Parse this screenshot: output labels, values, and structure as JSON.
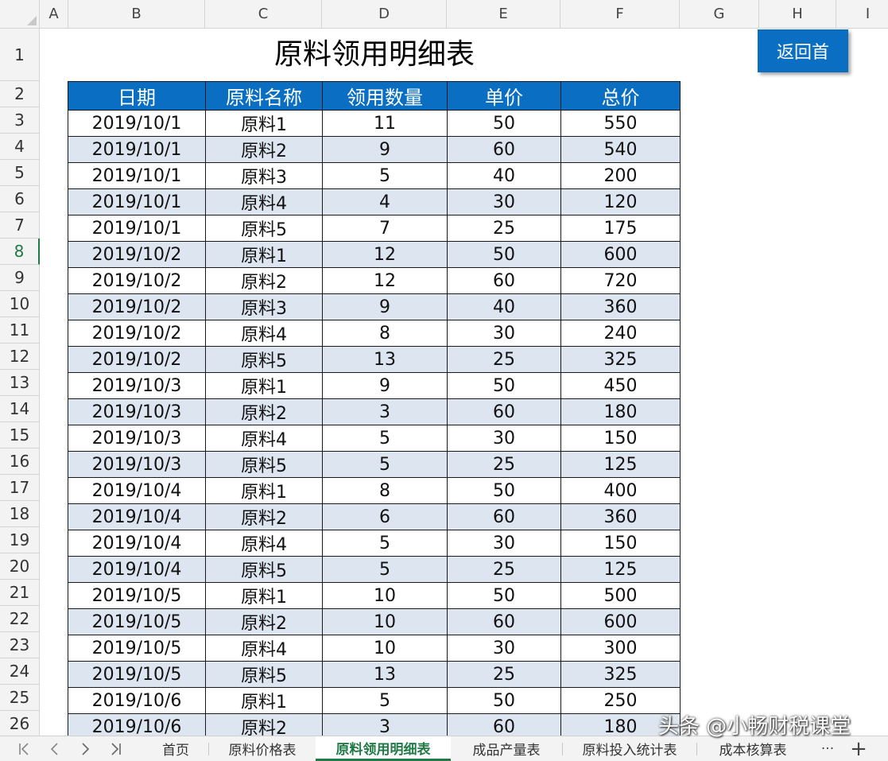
{
  "columns": [
    "A",
    "B",
    "C",
    "D",
    "E",
    "F",
    "G",
    "H",
    "I"
  ],
  "rows": [
    "1",
    "2",
    "3",
    "4",
    "5",
    "6",
    "7",
    "8",
    "9",
    "10",
    "11",
    "12",
    "13",
    "14",
    "15",
    "16",
    "17",
    "18",
    "19",
    "20",
    "21",
    "22",
    "23",
    "24",
    "25",
    "26"
  ],
  "title": "原料领用明细表",
  "return_button": "返回首",
  "table": {
    "headers": [
      "日期",
      "原料名称",
      "领用数量",
      "单价",
      "总价"
    ],
    "rows": [
      [
        "2019/10/1",
        "原料1",
        "11",
        "50",
        "550"
      ],
      [
        "2019/10/1",
        "原料2",
        "9",
        "60",
        "540"
      ],
      [
        "2019/10/1",
        "原料3",
        "5",
        "40",
        "200"
      ],
      [
        "2019/10/1",
        "原料4",
        "4",
        "30",
        "120"
      ],
      [
        "2019/10/1",
        "原料5",
        "7",
        "25",
        "175"
      ],
      [
        "2019/10/2",
        "原料1",
        "12",
        "50",
        "600"
      ],
      [
        "2019/10/2",
        "原料2",
        "12",
        "60",
        "720"
      ],
      [
        "2019/10/2",
        "原料3",
        "9",
        "40",
        "360"
      ],
      [
        "2019/10/2",
        "原料4",
        "8",
        "30",
        "240"
      ],
      [
        "2019/10/2",
        "原料5",
        "13",
        "25",
        "325"
      ],
      [
        "2019/10/3",
        "原料1",
        "9",
        "50",
        "450"
      ],
      [
        "2019/10/3",
        "原料2",
        "3",
        "60",
        "180"
      ],
      [
        "2019/10/3",
        "原料4",
        "5",
        "30",
        "150"
      ],
      [
        "2019/10/3",
        "原料5",
        "5",
        "25",
        "125"
      ],
      [
        "2019/10/4",
        "原料1",
        "8",
        "50",
        "400"
      ],
      [
        "2019/10/4",
        "原料2",
        "6",
        "60",
        "360"
      ],
      [
        "2019/10/4",
        "原料4",
        "5",
        "30",
        "150"
      ],
      [
        "2019/10/4",
        "原料5",
        "5",
        "25",
        "125"
      ],
      [
        "2019/10/5",
        "原料1",
        "10",
        "50",
        "500"
      ],
      [
        "2019/10/5",
        "原料2",
        "10",
        "60",
        "600"
      ],
      [
        "2019/10/5",
        "原料4",
        "10",
        "30",
        "300"
      ],
      [
        "2019/10/5",
        "原料5",
        "13",
        "25",
        "325"
      ],
      [
        "2019/10/6",
        "原料1",
        "5",
        "50",
        "250"
      ],
      [
        "2019/10/6",
        "原料2",
        "3",
        "60",
        "180"
      ]
    ]
  },
  "tabs": [
    {
      "label": "首页",
      "active": false
    },
    {
      "label": "原料价格表",
      "active": false
    },
    {
      "label": "原料领用明细表",
      "active": true
    },
    {
      "label": "成品产量表",
      "active": false
    },
    {
      "label": "原料投入统计表",
      "active": false
    },
    {
      "label": "成本核算表",
      "active": false
    }
  ],
  "tab_more": "···",
  "tab_add": "+",
  "nav": {
    "first": "|<",
    "prev": "<",
    "next": ">",
    "last": ">|"
  },
  "watermark": "头条 @小畅财税课堂",
  "active_row": "8",
  "colors": {
    "header_blue": "#0a6ec2",
    "alt_row": "#dde6f0",
    "active_green": "#1f7a45"
  }
}
